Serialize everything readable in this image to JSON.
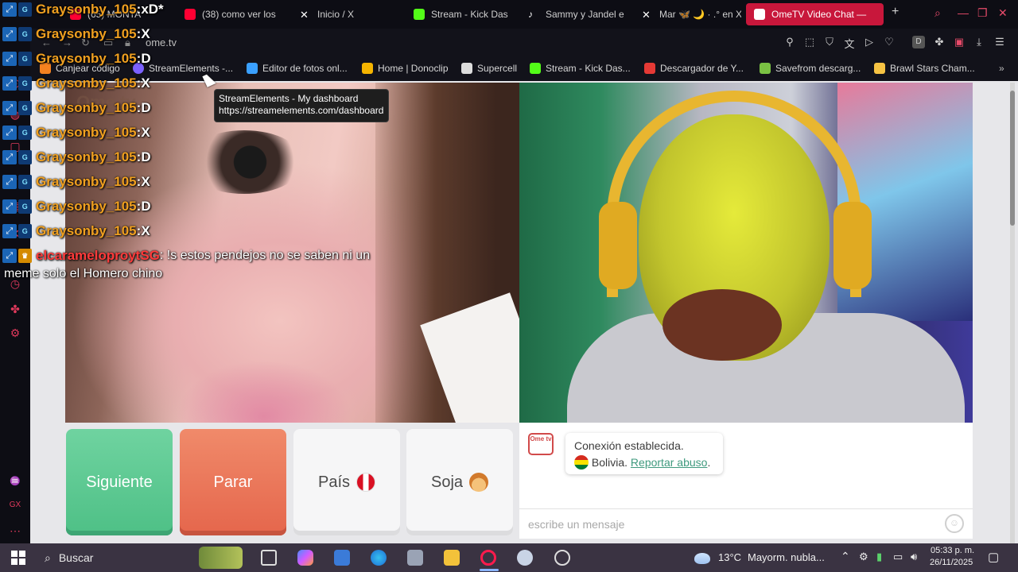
{
  "browser": {
    "tabs": [
      {
        "label": "(65) MONTA",
        "fav_color": "#ff0033"
      },
      {
        "label": "(38) como ver los",
        "fav_color": "#ff0033"
      },
      {
        "label": "Inicio / X",
        "fav_color": "#ffffff"
      },
      {
        "label": "Stream - Kick Das",
        "fav_color": "#53fc18"
      },
      {
        "label": "Sammy y Jandel e",
        "fav_color": "#ffffff"
      },
      {
        "label": "Mar 🦋 🌙 · .° en X",
        "fav_color": "#ffffff"
      },
      {
        "label": "OmeTV Video Chat —",
        "fav_color": "#ffffff",
        "active": true
      }
    ],
    "new_tab": "+",
    "url": "ome.tv",
    "bookmarks": [
      {
        "label": "Canjear código",
        "fav_color": "#f58220"
      },
      {
        "label": "StreamElements -...",
        "fav_color": "#7b61ff"
      },
      {
        "label": "Editor de fotos onl...",
        "fav_color": "#3aa0ff"
      },
      {
        "label": "Home | Donoclip",
        "fav_color": "#f5b400"
      },
      {
        "label": "Supercell",
        "fav_color": "#dddddd"
      },
      {
        "label": "Stream - Kick Das...",
        "fav_color": "#53fc18"
      },
      {
        "label": "Descargador de Y...",
        "fav_color": "#e53935"
      },
      {
        "label": "Savefrom descarg...",
        "fav_color": "#7ac143"
      },
      {
        "label": "Brawl Stars Cham...",
        "fav_color": "#f6c343"
      }
    ],
    "tooltip": {
      "title": "StreamElements - My dashboard",
      "url": "https://streamelements.com/dashboard"
    }
  },
  "page": {
    "watermark": "Ome.tv",
    "buttons": {
      "next": "Siguiente",
      "stop": "Parar",
      "country": "País",
      "gender": "Soja"
    },
    "system_message": {
      "logo": "Ome tv",
      "line1": "Conexión establecida.",
      "country": "Bolivia.",
      "report_link": "Reportar abuso",
      "report_suffix": "."
    },
    "message_placeholder": "escribe un mensaje"
  },
  "chat_overlay": [
    {
      "user": "Graysonby_105",
      "sep": " : ",
      "msg": "xD*"
    },
    {
      "user": "Graysonby_105",
      "sep": " : ",
      "msg": "X"
    },
    {
      "user": "Graysonby_105",
      "sep": " : ",
      "msg": "D"
    },
    {
      "user": "Graysonby_105",
      "sep": " : ",
      "msg": "X"
    },
    {
      "user": "Graysonby_105",
      "sep": " : ",
      "msg": "D"
    },
    {
      "user": "Graysonby_105",
      "sep": " : ",
      "msg": "X"
    },
    {
      "user": "Graysonby_105",
      "sep": " : ",
      "msg": "D"
    },
    {
      "user": "Graysonby_105",
      "sep": " : ",
      "msg": "X"
    },
    {
      "user": "Graysonby_105",
      "sep": " : ",
      "msg": "D"
    },
    {
      "user": "Graysonby_105",
      "sep": " : ",
      "msg": "X"
    }
  ],
  "chat_last": {
    "user": "elcarameloproytSG",
    "msg": " : !s estos pendejos no se saben ni un",
    "wrap": "meme solo el Homero chino"
  },
  "taskbar": {
    "search": "Buscar",
    "weather_temp": "13°C",
    "weather_text": "Mayorm. nubla...",
    "time": "05:33 p. m.",
    "date": "26/11/2025"
  }
}
